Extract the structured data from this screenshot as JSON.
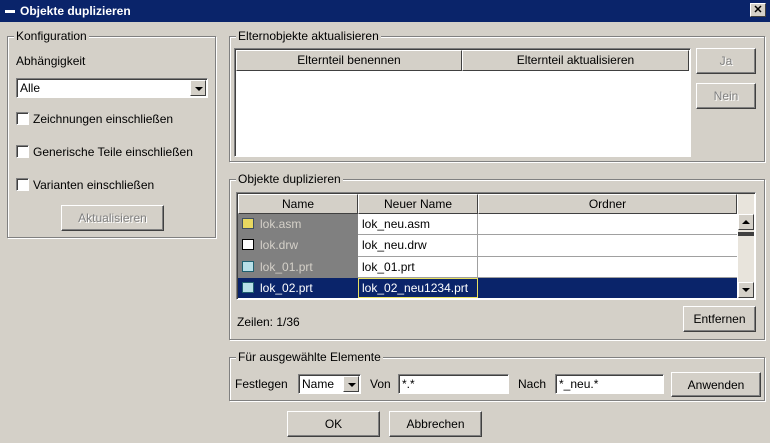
{
  "window": {
    "title": "Objekte duplizieren",
    "close_label": "✕"
  },
  "config": {
    "legend": "Konfiguration",
    "dependency_label": "Abhängigkeit",
    "dependency_value": "Alle",
    "checkboxes": [
      "Zeichnungen einschließen",
      "Generische Teile einschließen",
      "Varianten einschließen"
    ],
    "update_button": "Aktualisieren"
  },
  "parents": {
    "legend": "Elternobjekte aktualisieren",
    "columns": [
      "Elternteil benennen",
      "Elternteil aktualisieren"
    ],
    "yes_button": "Ja",
    "no_button": "Nein"
  },
  "duplicate": {
    "legend": "Objekte duplizieren",
    "columns": [
      "Name",
      "Neuer Name",
      "Ordner"
    ],
    "rows": [
      {
        "name": "lok.asm",
        "new_name": "lok_neu.asm",
        "folder": "",
        "icon": "assembly-icon"
      },
      {
        "name": "lok.drw",
        "new_name": "lok_neu.drw",
        "folder": "",
        "icon": "drawing-icon"
      },
      {
        "name": "lok_01.prt",
        "new_name": "lok_01.prt",
        "folder": "",
        "icon": "part-icon"
      },
      {
        "name": "lok_02.prt",
        "new_name": "lok_02_neu1234.prt",
        "folder": "",
        "icon": "part-icon"
      }
    ],
    "rows_status": "Zeilen: 1/36",
    "remove_button": "Entfernen"
  },
  "selected": {
    "legend": "Für ausgewählte Elemente",
    "set_label": "Festlegen",
    "set_value": "Name",
    "from_label": "Von",
    "from_value": "*.*",
    "to_label": "Nach",
    "to_value": "*_neu.*",
    "apply_button": "Anwenden"
  },
  "footer": {
    "ok": "OK",
    "cancel": "Abbrechen"
  },
  "colors": {
    "titlebar": "#0a246a",
    "selection": "#0a246a",
    "dialog_bg": "#d4d0c8",
    "name_col_bg": "#808080"
  }
}
